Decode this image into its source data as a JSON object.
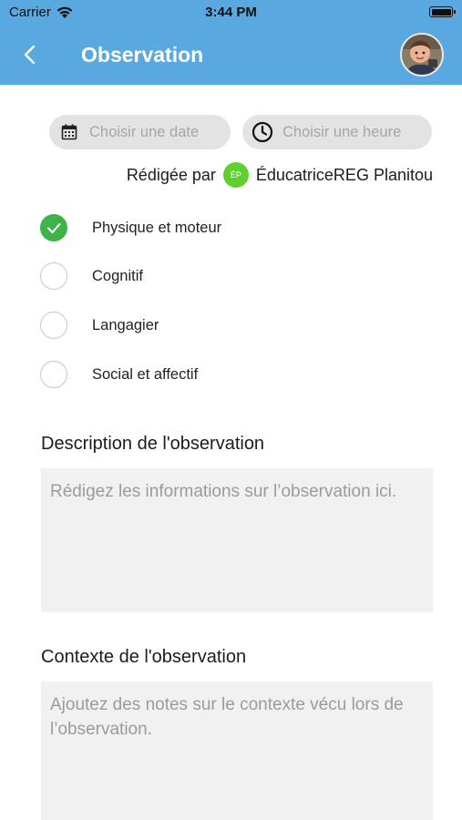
{
  "status_bar": {
    "carrier": "Carrier",
    "time": "3:44 PM"
  },
  "header": {
    "title": "Observation",
    "back_icon": "chevron-left-icon"
  },
  "datetime": {
    "date_placeholder": "Choisir une date",
    "time_placeholder": "Choisir une heure"
  },
  "author": {
    "prefix": "Rédigée par",
    "initials": "ÉP",
    "name": "ÉducatriceREG Planitou"
  },
  "categories": [
    {
      "label": "Physique et moteur",
      "checked": true
    },
    {
      "label": "Cognitif",
      "checked": false
    },
    {
      "label": "Langagier",
      "checked": false
    },
    {
      "label": "Social et affectif",
      "checked": false
    }
  ],
  "description": {
    "title": "Description de l'observation",
    "placeholder": "Rédigez les informations sur l’observation ici."
  },
  "context": {
    "title": "Contexte de l'observation",
    "placeholder": "Ajoutez des notes sur le contexte vécu lors de l’observation."
  },
  "colors": {
    "header_bg": "#5aa8e0",
    "check_green": "#3db34a",
    "initials_green": "#5fd02f"
  }
}
